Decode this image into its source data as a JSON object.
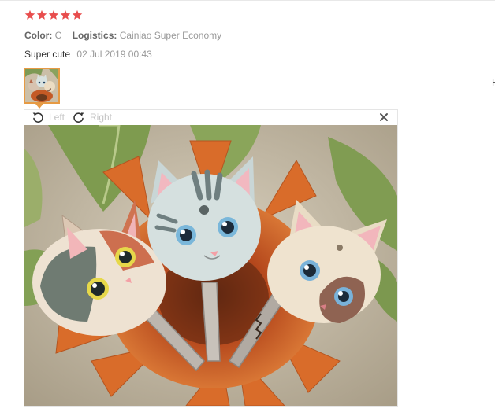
{
  "rating": {
    "stars": 5,
    "max": 5,
    "color": "#e84d4d"
  },
  "attributes": [
    {
      "label": "Color:",
      "value": "C"
    },
    {
      "label": "Logistics:",
      "value": "Cainiao Super Economy"
    }
  ],
  "review": {
    "text": "Super cute",
    "date": "02 Jul 2019 00:43"
  },
  "edge_text": "H",
  "viewer": {
    "rotate_left_label": "Left",
    "rotate_right_label": "Right",
    "accent_color": "#e69a44",
    "icons": [
      "rotate-left-icon",
      "rotate-right-icon",
      "close-icon"
    ]
  }
}
